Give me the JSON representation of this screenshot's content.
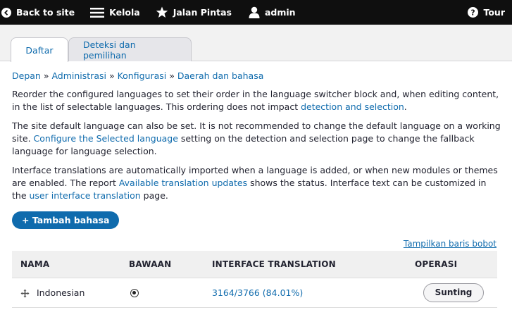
{
  "toolbar": {
    "back_label": "Back to site",
    "manage_label": "Kelola",
    "shortcuts_label": "Jalan Pintas",
    "user_label": "admin",
    "tour_label": "Tour"
  },
  "tabs": [
    {
      "label": "Daftar",
      "active": true
    },
    {
      "label": "Deteksi dan pemilihan",
      "active": false
    }
  ],
  "breadcrumb": {
    "items": [
      "Depan",
      "Administrasi",
      "Konfigurasi",
      "Daerah dan bahasa"
    ],
    "separator": "»"
  },
  "description": {
    "p1_text": "Reorder the configured languages to set their order in the language switcher block and, when editing content, in the list of selectable languages. This ordering does not impact ",
    "p1_link": "detection and selection",
    "p1_end": ".",
    "p2_text": "The site default language can also be set. It is not recommended to change the default language on a working site. ",
    "p2_link": "Configure the Selected language",
    "p2_end": " setting on the detection and selection page to change the fallback language for language selection.",
    "p3_text": "Interface translations are automatically imported when a language is added, or when new modules or themes are enabled. The report ",
    "p3_link1": "Available translation updates",
    "p3_mid": " shows the status. Interface text can be customized in the ",
    "p3_link2": "user interface translation",
    "p3_end": " page."
  },
  "add_button_label": "+ Tambah bahasa",
  "show_weights_label": "Tampilkan baris bobot",
  "table": {
    "headers": [
      "NAMA",
      "BAWAAN",
      "INTERFACE TRANSLATION",
      "OPERASI"
    ],
    "rows": [
      {
        "name": "Indonesian",
        "default": true,
        "translation": "3164/3766 (84.01%)",
        "operation": "Sunting"
      }
    ]
  },
  "colors": {
    "toolbar_bg": "#0f0f0f",
    "link": "#0f6bad",
    "primary_button": "#0f6bad"
  }
}
